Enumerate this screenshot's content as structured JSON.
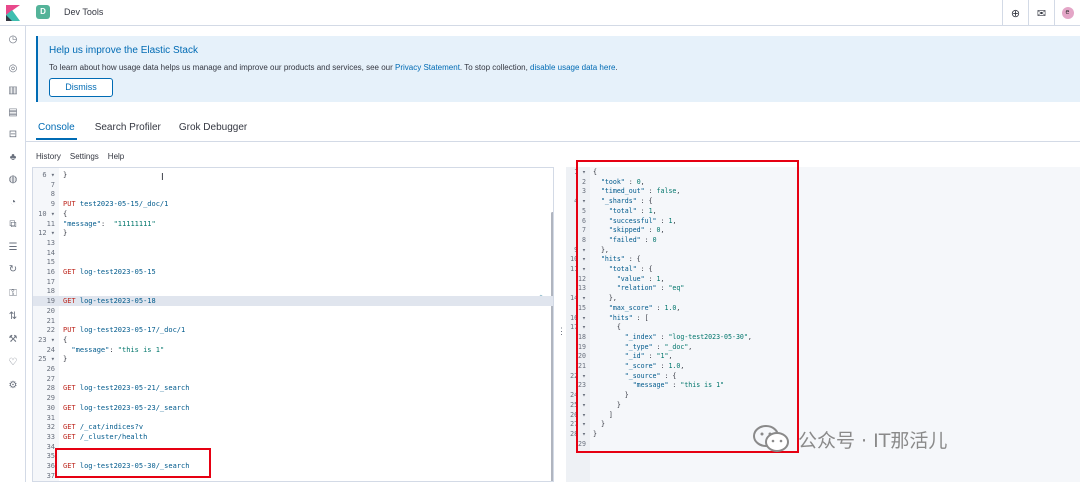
{
  "header": {
    "app_badge": "D",
    "app_title": "Dev Tools"
  },
  "callout": {
    "title": "Help us improve the Elastic Stack",
    "text_before": "To learn about how usage data helps us manage and improve our products and services, see our ",
    "privacy_link": "Privacy Statement",
    "text_middle": ". To stop collection, ",
    "disable_link": "disable usage data here",
    "text_after": ".",
    "dismiss_label": "Dismiss"
  },
  "tabs": [
    {
      "label": "Console"
    },
    {
      "label": "Search Profiler"
    },
    {
      "label": "Grok Debugger"
    }
  ],
  "subnav": {
    "history": "History",
    "settings": "Settings",
    "help": "Help"
  },
  "editor_lines": [
    {
      "n": "6",
      "fold": true,
      "parts": [
        [
          "k",
          "}"
        ]
      ]
    },
    {
      "n": "7",
      "parts": []
    },
    {
      "n": "8",
      "parts": []
    },
    {
      "n": "9",
      "parts": [
        [
          "m",
          "PUT "
        ],
        [
          "u",
          "test2023-05-15/_doc/1"
        ]
      ]
    },
    {
      "n": "10",
      "fold": true,
      "parts": [
        [
          "k",
          "{"
        ]
      ]
    },
    {
      "n": "11",
      "parts": [
        [
          "u",
          "\"message\""
        ],
        [
          "k",
          ":  "
        ],
        [
          "s",
          "\"11111111\""
        ]
      ]
    },
    {
      "n": "12",
      "fold": true,
      "parts": [
        [
          "k",
          "}"
        ]
      ]
    },
    {
      "n": "13",
      "parts": []
    },
    {
      "n": "14",
      "parts": []
    },
    {
      "n": "15",
      "parts": []
    },
    {
      "n": "16",
      "parts": [
        [
          "m",
          "GET "
        ],
        [
          "u",
          "log-test2023-05-15"
        ]
      ]
    },
    {
      "n": "17",
      "parts": []
    },
    {
      "n": "18",
      "parts": []
    },
    {
      "n": "19",
      "hl": true,
      "parts": [
        [
          "m",
          "GET "
        ],
        [
          "u",
          "log-test2023-05-18"
        ]
      ]
    },
    {
      "n": "20",
      "parts": []
    },
    {
      "n": "21",
      "parts": []
    },
    {
      "n": "22",
      "parts": [
        [
          "m",
          "PUT "
        ],
        [
          "u",
          "log-test2023-05-17/_doc/1"
        ]
      ]
    },
    {
      "n": "23",
      "fold": true,
      "parts": [
        [
          "k",
          "{"
        ]
      ]
    },
    {
      "n": "24",
      "parts": [
        [
          "u",
          "  \"message\""
        ],
        [
          "k",
          ": "
        ],
        [
          "s",
          "\"this is 1\""
        ]
      ]
    },
    {
      "n": "25",
      "fold": true,
      "parts": [
        [
          "k",
          "}"
        ]
      ]
    },
    {
      "n": "26",
      "parts": []
    },
    {
      "n": "27",
      "parts": []
    },
    {
      "n": "28",
      "parts": [
        [
          "m",
          "GET "
        ],
        [
          "u",
          "log-test2023-05-21/_search"
        ]
      ]
    },
    {
      "n": "29",
      "parts": []
    },
    {
      "n": "30",
      "parts": [
        [
          "m",
          "GET "
        ],
        [
          "u",
          "log-test2023-05-23/_search"
        ]
      ]
    },
    {
      "n": "31",
      "parts": []
    },
    {
      "n": "32",
      "parts": [
        [
          "m",
          "GET "
        ],
        [
          "u",
          "/_cat/indices?v"
        ]
      ]
    },
    {
      "n": "33",
      "parts": [
        [
          "m",
          "GET "
        ],
        [
          "u",
          "/_cluster/health"
        ]
      ]
    },
    {
      "n": "34",
      "parts": []
    },
    {
      "n": "35",
      "parts": []
    },
    {
      "n": "36",
      "parts": [
        [
          "m",
          "GET "
        ],
        [
          "u",
          "log-test2023-05-30/_search"
        ]
      ]
    },
    {
      "n": "37",
      "parts": []
    }
  ],
  "output_lines": [
    {
      "n": "1",
      "fold": true,
      "parts": [
        [
          "k",
          "{"
        ]
      ]
    },
    {
      "n": "2",
      "parts": [
        [
          "okey",
          "  \"took\""
        ],
        [
          "k",
          " : "
        ],
        [
          "onum",
          "0"
        ],
        [
          "k",
          ","
        ]
      ]
    },
    {
      "n": "3",
      "parts": [
        [
          "okey",
          "  \"timed_out\""
        ],
        [
          "k",
          " : "
        ],
        [
          "onum",
          "false"
        ],
        [
          "k",
          ","
        ]
      ]
    },
    {
      "n": "4",
      "fold": true,
      "parts": [
        [
          "okey",
          "  \"_shards\""
        ],
        [
          "k",
          " : {"
        ]
      ]
    },
    {
      "n": "5",
      "parts": [
        [
          "okey",
          "    \"total\""
        ],
        [
          "k",
          " : "
        ],
        [
          "onum",
          "1"
        ],
        [
          "k",
          ","
        ]
      ]
    },
    {
      "n": "6",
      "parts": [
        [
          "okey",
          "    \"successful\""
        ],
        [
          "k",
          " : "
        ],
        [
          "onum",
          "1"
        ],
        [
          "k",
          ","
        ]
      ]
    },
    {
      "n": "7",
      "parts": [
        [
          "okey",
          "    \"skipped\""
        ],
        [
          "k",
          " : "
        ],
        [
          "onum",
          "0"
        ],
        [
          "k",
          ","
        ]
      ]
    },
    {
      "n": "8",
      "parts": [
        [
          "okey",
          "    \"failed\""
        ],
        [
          "k",
          " : "
        ],
        [
          "onum",
          "0"
        ]
      ]
    },
    {
      "n": "9",
      "fold": true,
      "parts": [
        [
          "k",
          "  },"
        ]
      ]
    },
    {
      "n": "10",
      "fold": true,
      "parts": [
        [
          "okey",
          "  \"hits\""
        ],
        [
          "k",
          " : {"
        ]
      ]
    },
    {
      "n": "11",
      "fold": true,
      "parts": [
        [
          "okey",
          "    \"total\""
        ],
        [
          "k",
          " : {"
        ]
      ]
    },
    {
      "n": "12",
      "parts": [
        [
          "okey",
          "      \"value\""
        ],
        [
          "k",
          " : "
        ],
        [
          "onum",
          "1"
        ],
        [
          "k",
          ","
        ]
      ]
    },
    {
      "n": "13",
      "parts": [
        [
          "okey",
          "      \"relation\""
        ],
        [
          "k",
          " : "
        ],
        [
          "ostr",
          "\"eq\""
        ]
      ]
    },
    {
      "n": "14",
      "fold": true,
      "parts": [
        [
          "k",
          "    },"
        ]
      ]
    },
    {
      "n": "15",
      "parts": [
        [
          "okey",
          "    \"max_score\""
        ],
        [
          "k",
          " : "
        ],
        [
          "onum",
          "1.0"
        ],
        [
          "k",
          ","
        ]
      ]
    },
    {
      "n": "16",
      "fold": true,
      "parts": [
        [
          "okey",
          "    \"hits\""
        ],
        [
          "k",
          " : ["
        ]
      ]
    },
    {
      "n": "17",
      "fold": true,
      "parts": [
        [
          "k",
          "      {"
        ]
      ]
    },
    {
      "n": "18",
      "parts": [
        [
          "okey",
          "        \"_index\""
        ],
        [
          "k",
          " : "
        ],
        [
          "ostr",
          "\"log-test2023-05-30\""
        ],
        [
          "k",
          ","
        ]
      ]
    },
    {
      "n": "19",
      "parts": [
        [
          "okey",
          "        \"_type\""
        ],
        [
          "k",
          " : "
        ],
        [
          "ostr",
          "\"_doc\""
        ],
        [
          "k",
          ","
        ]
      ]
    },
    {
      "n": "20",
      "parts": [
        [
          "okey",
          "        \"_id\""
        ],
        [
          "k",
          " : "
        ],
        [
          "ostr",
          "\"1\""
        ],
        [
          "k",
          ","
        ]
      ]
    },
    {
      "n": "21",
      "parts": [
        [
          "okey",
          "        \"_score\""
        ],
        [
          "k",
          " : "
        ],
        [
          "onum",
          "1.0"
        ],
        [
          "k",
          ","
        ]
      ]
    },
    {
      "n": "22",
      "fold": true,
      "parts": [
        [
          "okey",
          "        \"_source\""
        ],
        [
          "k",
          " : {"
        ]
      ]
    },
    {
      "n": "23",
      "parts": [
        [
          "okey",
          "          \"message\""
        ],
        [
          "k",
          " : "
        ],
        [
          "ostr",
          "\"this is 1\""
        ]
      ]
    },
    {
      "n": "24",
      "fold": true,
      "parts": [
        [
          "k",
          "        }"
        ]
      ]
    },
    {
      "n": "25",
      "fold": true,
      "parts": [
        [
          "k",
          "      }"
        ]
      ]
    },
    {
      "n": "26",
      "fold": true,
      "parts": [
        [
          "k",
          "    ]"
        ]
      ]
    },
    {
      "n": "27",
      "fold": true,
      "parts": [
        [
          "k",
          "  }"
        ]
      ]
    },
    {
      "n": "28",
      "fold": true,
      "parts": [
        [
          "k",
          "}"
        ]
      ]
    },
    {
      "n": "29",
      "parts": []
    }
  ],
  "watermark": {
    "text": "公众号 · IT那活儿"
  },
  "colors": {
    "accent": "#006bb4",
    "highlight_box": "#e60012",
    "method": "#bd271e"
  }
}
